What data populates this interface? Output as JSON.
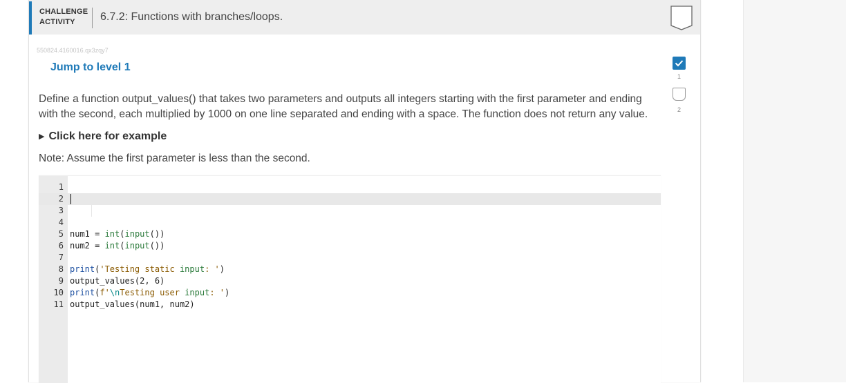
{
  "header": {
    "label_line1": "CHALLENGE",
    "label_line2": "ACTIVITY",
    "title": "6.7.2: Functions with branches/loops."
  },
  "activity_id": "550824.4160016.qx3zqy7",
  "jump_link": "Jump to level 1",
  "levels": [
    {
      "number": "1",
      "completed": true
    },
    {
      "number": "2",
      "completed": false
    }
  ],
  "prompt": "Define a function output_values() that takes two parameters and outputs all integers starting with the first parameter and ending with the second, each multiplied by 1000 on one line separated and ending with a space. The function does not return any value.",
  "example_toggle": "Click here for example",
  "note": "Note: Assume the first parameter is less than the second.",
  "editor": {
    "line_numbers": [
      "1",
      "2",
      "3",
      "4",
      "5",
      "6",
      "7",
      "8",
      "9",
      "10",
      "11"
    ],
    "lines": [
      "",
      "",
      "",
      "",
      "num1 = int(input())",
      "num2 = int(input())",
      "",
      "print('Testing static input: ')",
      "output_values(2, 6)",
      "print(f'\\nTesting user input: ')",
      "output_values(num1, num2)"
    ],
    "active_line": 2
  },
  "colors": {
    "accent": "#1f7ab8",
    "header_bg": "#eeeeee",
    "gutter_bg": "#ebebeb"
  },
  "icons": {
    "header_badge": "shield-outline-icon",
    "level_done": "check-icon",
    "example": "triangle-right-icon"
  }
}
